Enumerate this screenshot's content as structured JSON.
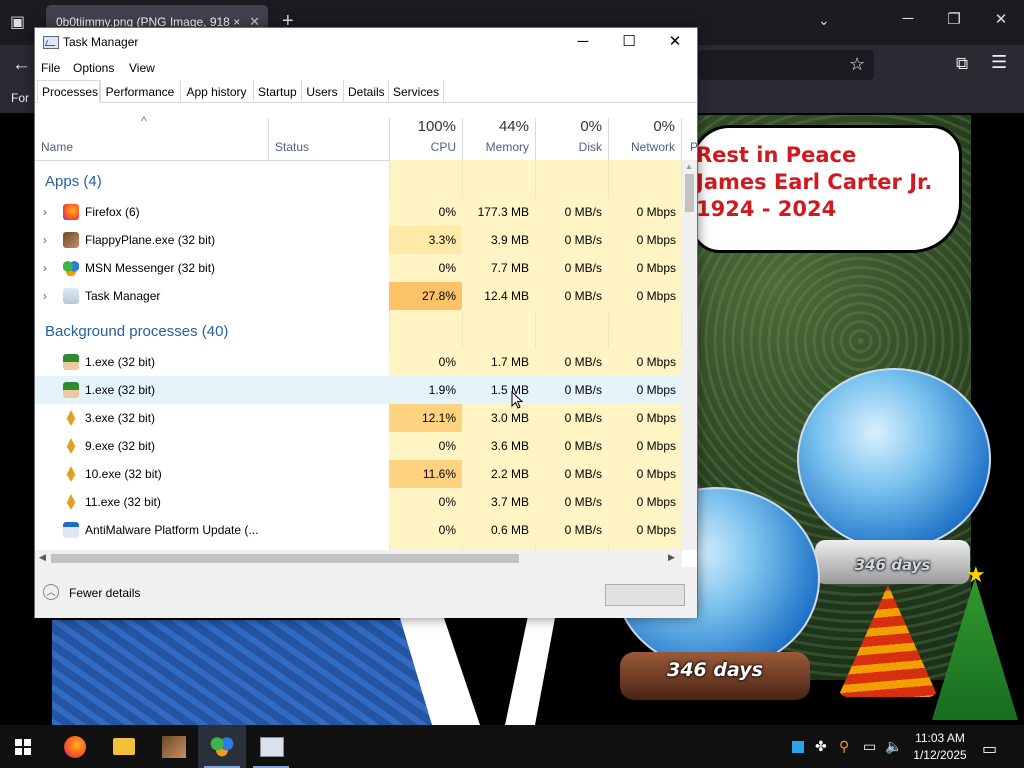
{
  "browser": {
    "tab_title": "0b0tiimmy.png (PNG Image, 918 ×",
    "bookmark_label": "For",
    "new_tab": "+",
    "tab_close": "✕",
    "list_all_tabs": "⌄"
  },
  "memorial": {
    "line1": "Rest in Peace",
    "line2": "James Earl Carter Jr.",
    "line3": "1924 - 2024"
  },
  "snowglobe_small_label": "346 days",
  "snowglobe_large_label": "346 days",
  "task_manager": {
    "title": "Task Manager",
    "menu": [
      "File",
      "Options",
      "View"
    ],
    "tabs": [
      "Processes",
      "Performance",
      "App history",
      "Startup",
      "Users",
      "Details",
      "Services"
    ],
    "active_tab": "Processes",
    "columns": {
      "name": "Name",
      "status": "Status",
      "cpu": {
        "pct": "100%",
        "label": "CPU"
      },
      "memory": {
        "pct": "44%",
        "label": "Memory"
      },
      "disk": {
        "pct": "0%",
        "label": "Disk"
      },
      "network": {
        "pct": "0%",
        "label": "Network"
      },
      "overflow": "P"
    },
    "groups": {
      "apps": "Apps (4)",
      "background": "Background processes (40)"
    },
    "apps": [
      {
        "name": "Firefox (6)",
        "cpu": "0%",
        "memory": "177.3 MB",
        "disk": "0 MB/s",
        "network": "0 Mbps",
        "icon": "firefox-icon"
      },
      {
        "name": "FlappyPlane.exe (32 bit)",
        "cpu": "3.3%",
        "memory": "3.9 MB",
        "disk": "0 MB/s",
        "network": "0 Mbps",
        "icon": "flappyplane-icon"
      },
      {
        "name": "MSN Messenger (32 bit)",
        "cpu": "0%",
        "memory": "7.7 MB",
        "disk": "0 MB/s",
        "network": "0 Mbps",
        "icon": "msn-messenger-icon"
      },
      {
        "name": "Task Manager",
        "cpu": "27.8%",
        "memory": "12.4 MB",
        "disk": "0 MB/s",
        "network": "0 Mbps",
        "icon": "task-manager-icon"
      }
    ],
    "background": [
      {
        "name": "1.exe (32 bit)",
        "cpu": "0%",
        "memory": "1.7 MB",
        "disk": "0 MB/s",
        "network": "0 Mbps",
        "icon": "elf-icon"
      },
      {
        "name": "1.exe (32 bit)",
        "cpu": "1.9%",
        "memory": "1.5 MB",
        "disk": "0 MB/s",
        "network": "0 Mbps",
        "icon": "elf-icon"
      },
      {
        "name": "3.exe (32 bit)",
        "cpu": "12.1%",
        "memory": "3.0 MB",
        "disk": "0 MB/s",
        "network": "0 Mbps",
        "icon": "tree-icon"
      },
      {
        "name": "9.exe (32 bit)",
        "cpu": "0%",
        "memory": "3.6 MB",
        "disk": "0 MB/s",
        "network": "0 Mbps",
        "icon": "tree-icon"
      },
      {
        "name": "10.exe (32 bit)",
        "cpu": "11.6%",
        "memory": "2.2 MB",
        "disk": "0 MB/s",
        "network": "0 Mbps",
        "icon": "tree-icon"
      },
      {
        "name": "11.exe (32 bit)",
        "cpu": "0%",
        "memory": "3.7 MB",
        "disk": "0 MB/s",
        "network": "0 Mbps",
        "icon": "tree-icon"
      },
      {
        "name": "AntiMalware Platform Update (...",
        "cpu": "0%",
        "memory": "0.6 MB",
        "disk": "0 MB/s",
        "network": "0 Mbps",
        "icon": "window-icon"
      }
    ],
    "footer": {
      "fewer_details": "Fewer details"
    }
  },
  "taskbar": {
    "time": "11:03 AM",
    "date": "1/12/2025"
  },
  "colors": {
    "heat_light": "#fff4c4",
    "heat_mid": "#ffe9a8",
    "heat_high": "#ffd27f",
    "heat_max": "#fcc268",
    "group_blue": "#245ea8",
    "memorial_red": "#d01a20"
  }
}
